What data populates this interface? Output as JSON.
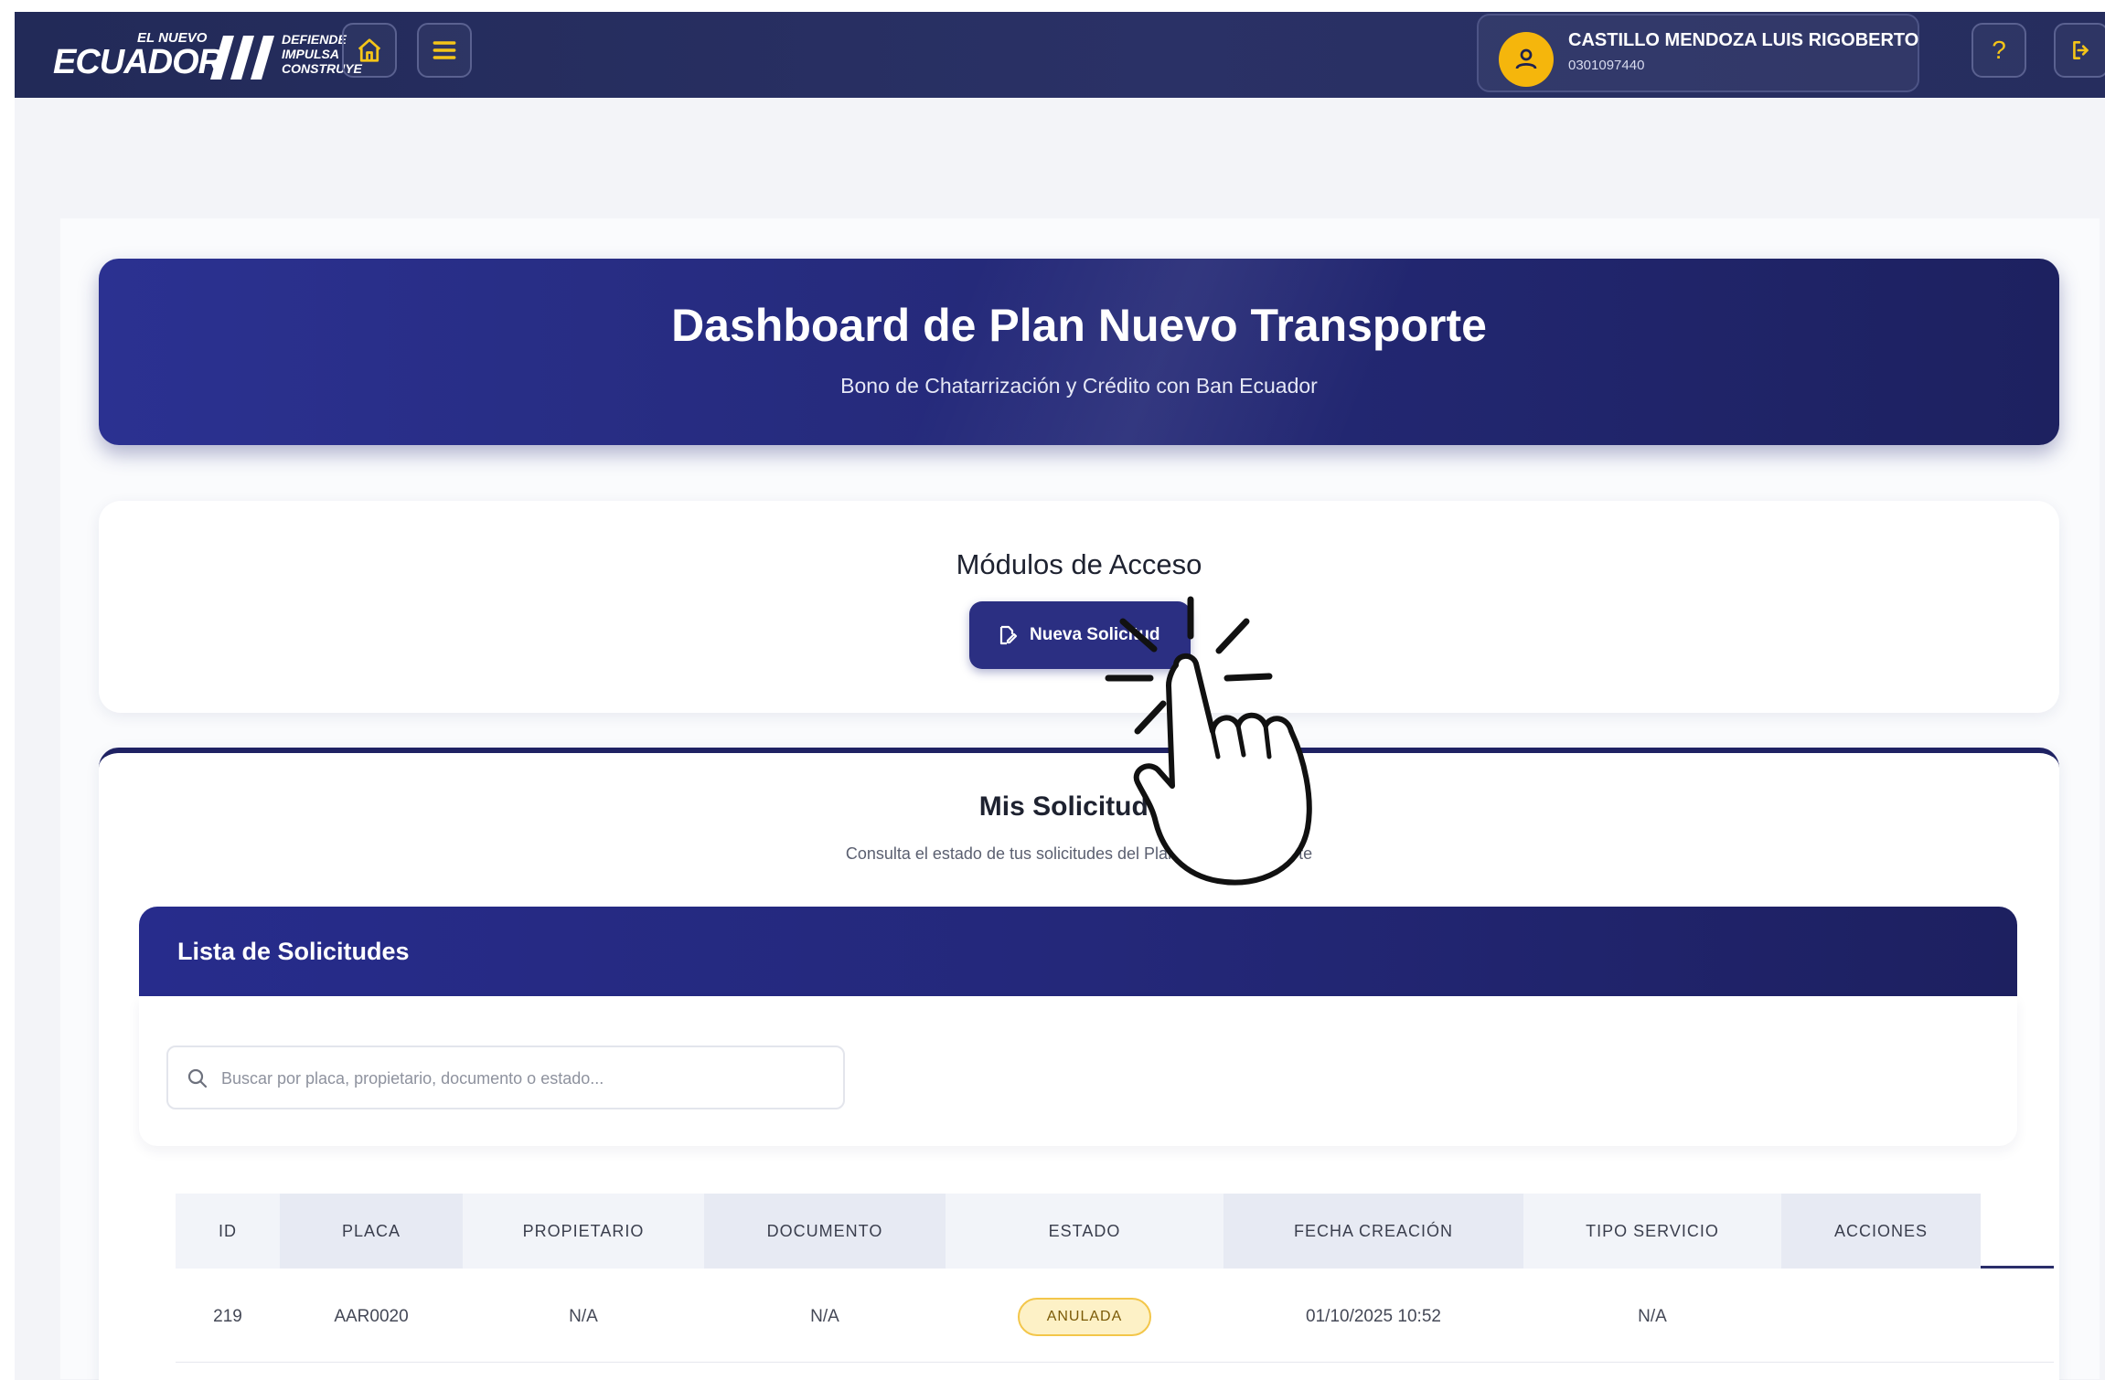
{
  "topbar": {
    "logo": {
      "pre": "EL NUEVO",
      "main": "ECUADOR",
      "slogan": [
        "DEFIENDE",
        "IMPULSA",
        "CONSTRUYE"
      ]
    },
    "icons": {
      "home": "home-icon",
      "menu": "menu-icon",
      "help": "help-icon",
      "logout": "logout-icon"
    },
    "help_label": "?",
    "user": {
      "name": "CASTILLO MENDOZA LUIS RIGOBERTO",
      "document": "0301097440",
      "icon": "user-icon"
    }
  },
  "hero": {
    "title": "Dashboard de Plan Nuevo Transporte",
    "subtitle": "Bono de Chatarrización y Crédito con Ban Ecuador"
  },
  "modules": {
    "title": "Módulos de Acceso",
    "new_request_label": "Nueva Solicitud",
    "new_request_icon": "edit-icon"
  },
  "requests": {
    "title": "Mis Solicitudes",
    "subtitle": "Consulta el estado de tus solicitudes del Plan Nuevo Transporte",
    "list_title": "Lista de Solicitudes",
    "search_placeholder": "Buscar por placa, propietario, documento o estado...",
    "columns": [
      "ID",
      "PLACA",
      "PROPIETARIO",
      "DOCUMENTO",
      "ESTADO",
      "FECHA CREACIÓN",
      "TIPO SERVICIO",
      "ACCIONES"
    ],
    "rows": [
      {
        "id": "219",
        "placa": "AAR0020",
        "propietario": "N/A",
        "documento": "N/A",
        "estado": "ANULADA",
        "fecha": "01/10/2025 10:52",
        "tipo": "N/A",
        "acciones": ""
      }
    ]
  },
  "colors": {
    "nav": "#262d5e",
    "primary": "#2b2f82",
    "accent": "#f5b60c",
    "badge_bg": "#fdf1c6",
    "badge_border": "#f3c64a"
  }
}
